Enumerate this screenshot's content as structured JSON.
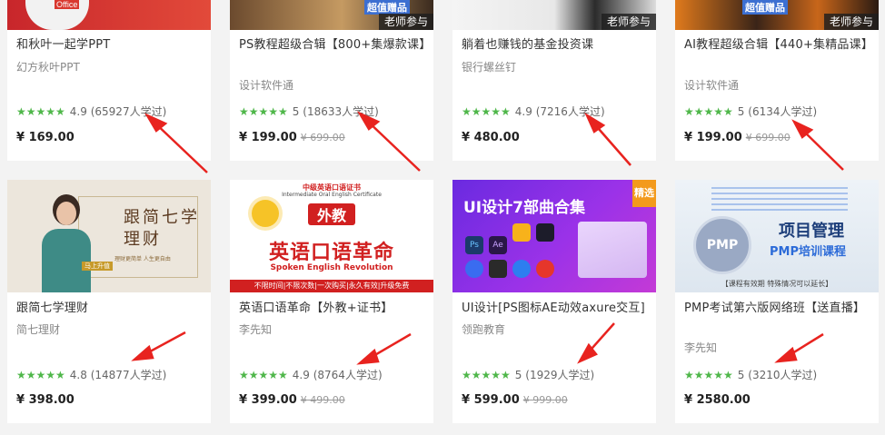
{
  "cards": [
    {
      "title": "和秋叶一起学PPT",
      "author": "幻方秋叶PPT",
      "rating": "4.9",
      "learners": "(65927人学过)",
      "price": "¥ 169.00",
      "original": "",
      "badge": "",
      "thumb_text": "Office"
    },
    {
      "title": "PS教程超级合辑【800+集爆款课】",
      "author": "设计软件通",
      "rating": "5",
      "learners": "(18633人学过)",
      "price": "¥ 199.00",
      "original": "¥ 699.00",
      "badge": "老师参与",
      "thumb_text": "超值赠品"
    },
    {
      "title": "躺着也赚钱的基金投资课",
      "author": "银行螺丝钉",
      "rating": "4.9",
      "learners": "(7216人学过)",
      "price": "¥ 480.00",
      "original": "",
      "badge": "老师参与",
      "thumb_text": ""
    },
    {
      "title": "AI教程超级合辑【440+集精品课】",
      "author": "设计软件通",
      "rating": "5",
      "learners": "(6134人学过)",
      "price": "¥ 199.00",
      "original": "¥ 699.00",
      "badge": "老师参与",
      "thumb_text": "超值赠品"
    },
    {
      "title": "跟简七学理财",
      "author": "简七理财",
      "rating": "4.8",
      "learners": "(14877人学过)",
      "price": "¥ 398.00",
      "original": "",
      "badge": "",
      "thumb_text": "跟简七学理财",
      "thumb_sub": "理财更简单 人生更自由",
      "thumb_tag": "马上升值"
    },
    {
      "title": "英语口语革命【外教+证书】",
      "author": "李先知",
      "rating": "4.9",
      "learners": "(8764人学过)",
      "price": "¥ 399.00",
      "original": "¥ 499.00",
      "badge": "",
      "thumb_top": "中级英语口语证书",
      "thumb_top_en": "Intermediate Oral English Certificate",
      "thumb_tag": "外教",
      "thumb_main": "英语口语革命",
      "thumb_en": "Spoken English Revolution",
      "thumb_bottom": "不限时间|不限次数|一次购买|永久有效|升级免费"
    },
    {
      "title": "UI设计[PS图标AE动效axure交互]",
      "author": "领跑教育",
      "rating": "5",
      "learners": "(1929人学过)",
      "price": "¥ 599.00",
      "original": "¥ 999.00",
      "badge": "",
      "thumb_main": "UI设计7部曲合集",
      "thumb_tag": "精选"
    },
    {
      "title": "PMP考试第六版网络班【送直播】",
      "author": "李先知",
      "rating": "5",
      "learners": "(3210人学过)",
      "price": "¥ 2580.00",
      "original": "",
      "badge": "",
      "thumb_main": "项目管理",
      "thumb_sub": "PMP培训课程",
      "thumb_logo": "PMP",
      "thumb_bottom": "【课程有效期 特殊情况可以延长】"
    }
  ],
  "stars": "★★★★★",
  "colors": {
    "star": "#4fb74a",
    "arrow": "#e8231f"
  }
}
